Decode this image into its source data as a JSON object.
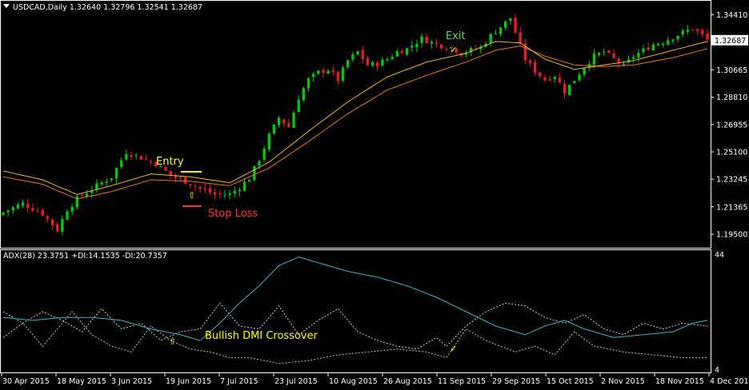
{
  "window": {
    "symbol_info": "USDCAD,Daily  1.32640 1.32796 1.32541 1.32687",
    "indicator_info": "ADX(28) 23.3751 +DI:14.1535 -DI:20.7357"
  },
  "colors": {
    "background": "#000000",
    "bull": "#00c800",
    "bear": "#e61e1e",
    "ma_fast": "#f0b428",
    "ma_slow": "#e6781e",
    "adx": "#3cb4c8",
    "di_plus": "#c8c896",
    "di_minus": "#d2d2d2",
    "axis_text": "#ffffff",
    "entry": "#ffff3c",
    "exit": "#5adc5a",
    "stop": "#ff3c28",
    "annotation": "#ffff00"
  },
  "annotations": {
    "entry": "Entry",
    "exit": "Exit",
    "stop_loss": "Stop Loss",
    "crossover": "Bullish DMI Crossover"
  },
  "chart_data": [
    {
      "type": "candlestick",
      "symbol": "USDCAD",
      "timeframe": "Daily",
      "ohlc_last": {
        "open": 1.3264,
        "high": 1.32796,
        "low": 1.32541,
        "close": 1.32687
      },
      "ylim": [
        1.188,
        1.352
      ],
      "y_ticks": [
        "1.34410",
        "1.32687",
        "1.30665",
        "1.28810",
        "1.26955",
        "1.25100",
        "1.23245",
        "1.21365",
        "1.19500"
      ],
      "y_tick_values": [
        1.3441,
        1.32687,
        1.30665,
        1.2881,
        1.26955,
        1.251,
        1.23245,
        1.21365,
        1.195
      ],
      "current_price": "1.32687",
      "x_ticks": [
        "30 Apr 2015",
        "18 May 2015",
        "3 Jun 2015",
        "19 Jun 2015",
        "7 Jul 2015",
        "23 Jul 2015",
        "10 Aug 2015",
        "26 Aug 2015",
        "11 Sep 2015",
        "29 Sep 2015",
        "15 Oct 2015",
        "2 Nov 2015",
        "18 Nov 2015",
        "4 Dec 2015"
      ],
      "close_path": [
        [
          0,
          1.21
        ],
        [
          4,
          1.216
        ],
        [
          8,
          1.209
        ],
        [
          11,
          1.198
        ],
        [
          13,
          1.212
        ],
        [
          15,
          1.219
        ],
        [
          19,
          1.228
        ],
        [
          22,
          1.234
        ],
        [
          25,
          1.251
        ],
        [
          28,
          1.247
        ],
        [
          31,
          1.243
        ],
        [
          34,
          1.235
        ],
        [
          37,
          1.231
        ],
        [
          40,
          1.226
        ],
        [
          43,
          1.222
        ],
        [
          46,
          1.222
        ],
        [
          48,
          1.227
        ],
        [
          50,
          1.233
        ],
        [
          52,
          1.246
        ],
        [
          54,
          1.262
        ],
        [
          56,
          1.274
        ],
        [
          58,
          1.268
        ],
        [
          60,
          1.288
        ],
        [
          62,
          1.3
        ],
        [
          64,
          1.305
        ],
        [
          66,
          1.307
        ],
        [
          68,
          1.3
        ],
        [
          70,
          1.313
        ],
        [
          72,
          1.319
        ],
        [
          74,
          1.31
        ],
        [
          76,
          1.311
        ],
        [
          78,
          1.314
        ],
        [
          80,
          1.319
        ],
        [
          82,
          1.321
        ],
        [
          85,
          1.328
        ],
        [
          88,
          1.324
        ],
        [
          91,
          1.322
        ],
        [
          93,
          1.318
        ],
        [
          95,
          1.32
        ],
        [
          97,
          1.322
        ],
        [
          99,
          1.33
        ],
        [
          101,
          1.336
        ],
        [
          103,
          1.342
        ],
        [
          104,
          1.332
        ],
        [
          106,
          1.314
        ],
        [
          108,
          1.306
        ],
        [
          110,
          1.3
        ],
        [
          112,
          1.303
        ],
        [
          114,
          1.292
        ],
        [
          116,
          1.3
        ],
        [
          118,
          1.309
        ],
        [
          120,
          1.316
        ],
        [
          122,
          1.319
        ],
        [
          124,
          1.314
        ],
        [
          126,
          1.309
        ],
        [
          128,
          1.316
        ],
        [
          130,
          1.32
        ],
        [
          132,
          1.324
        ],
        [
          134,
          1.326
        ],
        [
          136,
          1.329
        ],
        [
          138,
          1.332
        ],
        [
          140,
          1.335
        ],
        [
          142,
          1.33
        ],
        [
          143,
          1.327
        ]
      ],
      "ma_fast_path": [
        [
          0,
          1.238
        ],
        [
          8,
          1.232
        ],
        [
          15,
          1.222
        ],
        [
          22,
          1.228
        ],
        [
          30,
          1.236
        ],
        [
          38,
          1.234
        ],
        [
          46,
          1.23
        ],
        [
          54,
          1.244
        ],
        [
          62,
          1.265
        ],
        [
          70,
          1.285
        ],
        [
          78,
          1.302
        ],
        [
          86,
          1.312
        ],
        [
          94,
          1.318
        ],
        [
          100,
          1.326
        ],
        [
          105,
          1.325
        ],
        [
          110,
          1.314
        ],
        [
          116,
          1.307
        ],
        [
          122,
          1.31
        ],
        [
          128,
          1.313
        ],
        [
          136,
          1.32
        ],
        [
          143,
          1.326
        ]
      ],
      "ma_slow_path": [
        [
          0,
          1.234
        ],
        [
          8,
          1.229
        ],
        [
          15,
          1.219
        ],
        [
          22,
          1.224
        ],
        [
          30,
          1.232
        ],
        [
          38,
          1.231
        ],
        [
          46,
          1.228
        ],
        [
          54,
          1.24
        ],
        [
          62,
          1.258
        ],
        [
          70,
          1.277
        ],
        [
          78,
          1.293
        ],
        [
          86,
          1.303
        ],
        [
          94,
          1.312
        ],
        [
          100,
          1.32
        ],
        [
          105,
          1.323
        ],
        [
          110,
          1.316
        ],
        [
          116,
          1.31
        ],
        [
          122,
          1.309
        ],
        [
          128,
          1.31
        ],
        [
          136,
          1.315
        ],
        [
          143,
          1.321
        ]
      ],
      "entry_price": 1.2375,
      "stop_loss_price": 1.214
    },
    {
      "type": "line",
      "name": "ADX(28)",
      "ylim": [
        4,
        44
      ],
      "y_ticks": [
        "44",
        "4"
      ],
      "y_tick_values": [
        44,
        4
      ],
      "adx_path": [
        [
          0,
          22
        ],
        [
          6,
          21
        ],
        [
          12,
          22
        ],
        [
          18,
          22
        ],
        [
          24,
          21
        ],
        [
          30,
          18
        ],
        [
          36,
          16
        ],
        [
          40,
          14
        ],
        [
          44,
          20
        ],
        [
          48,
          27
        ],
        [
          52,
          33
        ],
        [
          56,
          40
        ],
        [
          60,
          43
        ],
        [
          64,
          41
        ],
        [
          70,
          38
        ],
        [
          76,
          36
        ],
        [
          82,
          33
        ],
        [
          88,
          29
        ],
        [
          94,
          24
        ],
        [
          100,
          19
        ],
        [
          106,
          16
        ],
        [
          110,
          19
        ],
        [
          114,
          21
        ],
        [
          118,
          18
        ],
        [
          124,
          15
        ],
        [
          130,
          16
        ],
        [
          136,
          17
        ],
        [
          140,
          20
        ],
        [
          143,
          21
        ]
      ],
      "di_plus_path": [
        [
          0,
          15
        ],
        [
          4,
          20
        ],
        [
          8,
          12
        ],
        [
          14,
          24
        ],
        [
          18,
          16
        ],
        [
          22,
          12
        ],
        [
          26,
          10
        ],
        [
          30,
          19
        ],
        [
          34,
          14
        ],
        [
          38,
          11
        ],
        [
          42,
          10
        ],
        [
          46,
          8
        ],
        [
          50,
          8
        ],
        [
          56,
          6
        ],
        [
          62,
          7
        ],
        [
          68,
          9
        ],
        [
          74,
          10
        ],
        [
          80,
          11
        ],
        [
          86,
          10
        ],
        [
          90,
          8
        ],
        [
          94,
          18
        ],
        [
          98,
          14
        ],
        [
          104,
          10
        ],
        [
          108,
          12
        ],
        [
          112,
          9
        ],
        [
          116,
          17
        ],
        [
          120,
          12
        ],
        [
          126,
          10
        ],
        [
          132,
          9
        ],
        [
          138,
          8
        ],
        [
          143,
          8
        ]
      ],
      "di_minus_path": [
        [
          0,
          24
        ],
        [
          4,
          20
        ],
        [
          8,
          24
        ],
        [
          12,
          21
        ],
        [
          16,
          17
        ],
        [
          20,
          25
        ],
        [
          24,
          18
        ],
        [
          28,
          20
        ],
        [
          32,
          14
        ],
        [
          36,
          17
        ],
        [
          40,
          18
        ],
        [
          44,
          27
        ],
        [
          48,
          19
        ],
        [
          52,
          18
        ],
        [
          56,
          26
        ],
        [
          60,
          16
        ],
        [
          64,
          21
        ],
        [
          68,
          25
        ],
        [
          72,
          17
        ],
        [
          76,
          14
        ],
        [
          80,
          12
        ],
        [
          84,
          11
        ],
        [
          88,
          15
        ],
        [
          90,
          12
        ],
        [
          94,
          19
        ],
        [
          98,
          24
        ],
        [
          102,
          27
        ],
        [
          106,
          26
        ],
        [
          110,
          22
        ],
        [
          114,
          20
        ],
        [
          118,
          23
        ],
        [
          122,
          18
        ],
        [
          126,
          16
        ],
        [
          130,
          20
        ],
        [
          134,
          18
        ],
        [
          138,
          20
        ],
        [
          143,
          19
        ]
      ]
    }
  ]
}
